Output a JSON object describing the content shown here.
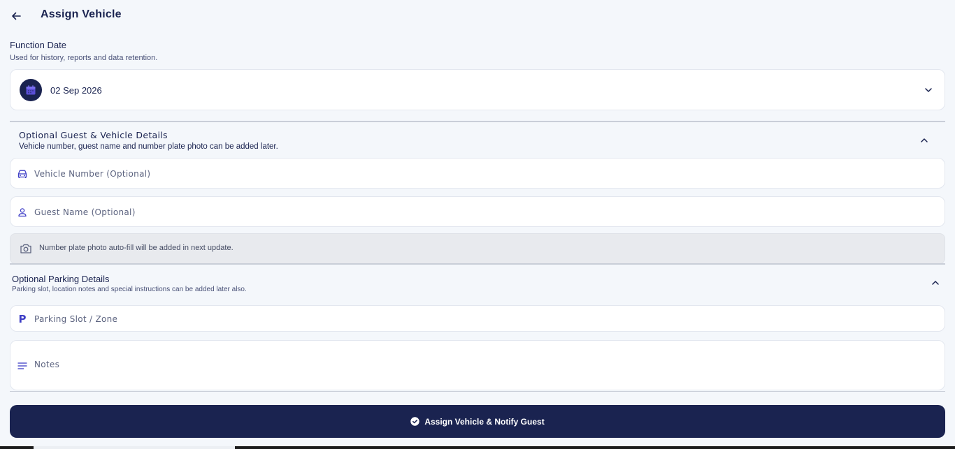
{
  "header": {
    "title": "Assign Vehicle"
  },
  "function_date": {
    "title": "Function Date",
    "subtitle": "Used for history, reports and data retention.",
    "value": "02 Sep 2026"
  },
  "guest_section": {
    "title": "Optional Guest & Vehicle Details",
    "subtitle": "Vehicle number, guest name and number plate photo can be added later.",
    "vehicle_placeholder": "Vehicle Number (Optional)",
    "guest_placeholder": "Guest Name (Optional)",
    "photo_note": "Number plate photo auto-fill will be added in next update."
  },
  "parking_section": {
    "title": "Optional Parking Details",
    "subtitle": "Parking slot, location notes and special instructions can be added later also.",
    "slot_placeholder": "Parking Slot / Zone",
    "notes_placeholder": "Notes"
  },
  "submit": {
    "label": "Assign Vehicle & Notify Guest"
  },
  "icons": {
    "back": "arrow-left-icon",
    "calendar": "calendar-icon",
    "chevron": "chevron-icon",
    "car": "car-icon",
    "person": "person-icon",
    "camera": "camera-icon",
    "parking": "P",
    "notes": "notes-lines-icon",
    "check": "check-circle-icon"
  },
  "colors": {
    "primary": "#1a2350",
    "accent": "#3f3fc6",
    "background": "#f4f7fb",
    "card": "#ffffff",
    "info_box": "#e8eaee"
  }
}
